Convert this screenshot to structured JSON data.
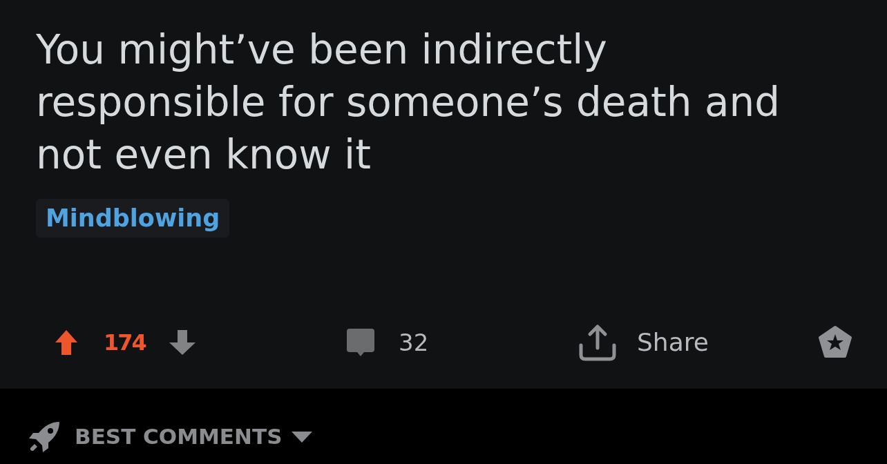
{
  "post": {
    "title": "You might’ve been indirectly responsible for someone’s death and not even know it",
    "flair": "Mindblowing"
  },
  "actions": {
    "vote": {
      "upvoted": true,
      "score": "174"
    },
    "comments": "32",
    "share": "Share"
  },
  "sort": {
    "label": "BEST COMMENTS"
  }
}
